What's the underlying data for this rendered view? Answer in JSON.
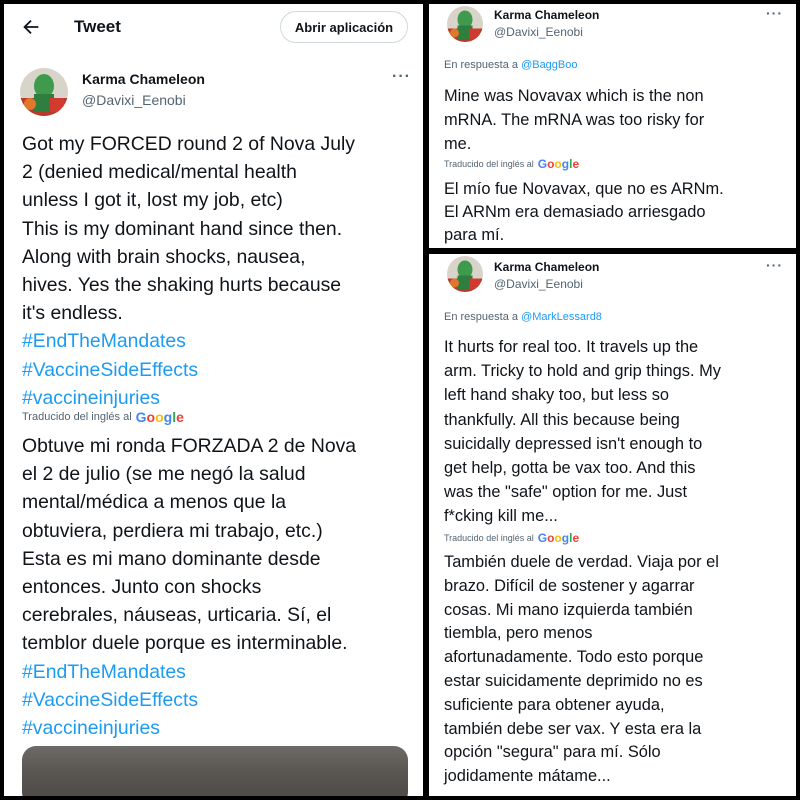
{
  "header": {
    "title": "Tweet",
    "open_app_label": "Abrir aplicación"
  },
  "author": {
    "name": "Karma Chameleon",
    "handle": "@Davixi_Eenobi"
  },
  "translated_label": "Traducido del inglés al",
  "google_letters": [
    "G",
    "o",
    "o",
    "g",
    "l",
    "e"
  ],
  "main_tweet": {
    "original_lines": [
      "Got my FORCED round 2 of Nova July",
      "2 (denied medical/mental health",
      "unless I got it, lost my job, etc)",
      "This is my dominant hand since then.",
      "Along with brain shocks, nausea,",
      "hives. Yes the shaking hurts because",
      "it's endless."
    ],
    "original_hashtags": [
      "#EndTheMandates",
      "#VaccineSideEffects",
      "#vaccineinjuries"
    ],
    "translated_lines": [
      "Obtuve mi ronda FORZADA 2 de Nova",
      "el 2 de julio (se me negó la salud",
      "mental/médica a menos que la",
      "obtuviera, perdiera mi trabajo, etc.)",
      " Esta es mi mano dominante desde",
      "entonces. Junto con shocks",
      "cerebrales, náuseas, urticaria. Sí, el",
      "temblor duele porque es interminable."
    ],
    "translated_hashtags": [
      "#EndTheMandates",
      "#VaccineSideEffects",
      "#vaccineinjuries"
    ]
  },
  "reply1": {
    "reply_prefix": "En respuesta a",
    "reply_to": "@BaggBoo",
    "original_lines": [
      "Mine was Novavax which is the non",
      "mRNA. The mRNA was too risky for",
      "me."
    ],
    "translated_lines": [
      "El mío fue Novavax, que no es ARNm.",
      "El ARNm era demasiado arriesgado",
      "para mí."
    ]
  },
  "reply2": {
    "reply_prefix": "En respuesta a",
    "reply_to": "@MarkLessard8",
    "original_lines": [
      "It hurts for real too. It travels up the",
      "arm. Tricky to hold and grip things. My",
      "left hand shaky too, but less so",
      "thankfully. All this because being",
      "suicidally depressed isn't enough to",
      "get help, gotta be vax too. And this",
      "was the \"safe\" option for me. Just",
      "f*cking kill me..."
    ],
    "translated_lines": [
      "También duele de verdad. Viaja por el",
      "brazo. Difícil de sostener y agarrar",
      "cosas. Mi mano izquierda también",
      "tiembla, pero menos",
      "afortunadamente. Todo esto porque",
      "estar suicidamente deprimido no es",
      "suficiente para obtener ayuda,",
      "también debe ser vax. Y esta era la",
      "opción \"segura\" para mí. Sólo",
      "jodidamente mátame..."
    ]
  },
  "colors": {
    "link": "#1d9bf0",
    "text": "#0f1419",
    "muted": "#536471",
    "frame": "#000000"
  }
}
